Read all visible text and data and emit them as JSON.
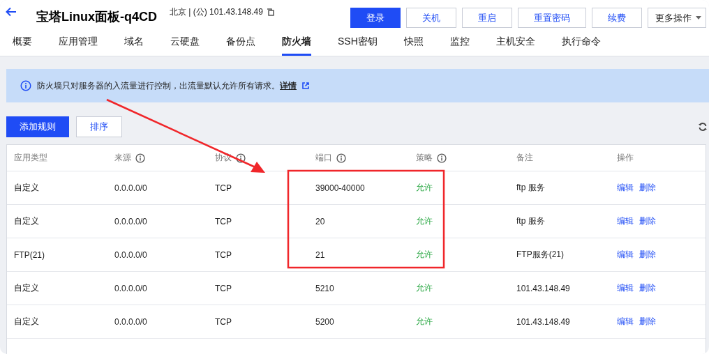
{
  "header": {
    "title": "宝塔Linux面板-q4CD",
    "location": "北京 | (公) 101.43.148.49",
    "buttons": [
      {
        "label": "登录",
        "primary": true
      },
      {
        "label": "关机",
        "primary": false
      },
      {
        "label": "重启",
        "primary": false
      },
      {
        "label": "重置密码",
        "primary": false
      },
      {
        "label": "续费",
        "primary": false
      }
    ],
    "more": "更多操作"
  },
  "tabs": [
    {
      "label": "概要",
      "selected": false
    },
    {
      "label": "应用管理",
      "selected": false
    },
    {
      "label": "域名",
      "selected": false
    },
    {
      "label": "云硬盘",
      "selected": false
    },
    {
      "label": "备份点",
      "selected": false
    },
    {
      "label": "防火墙",
      "selected": true
    },
    {
      "label": "SSH密钥",
      "selected": false
    },
    {
      "label": "快照",
      "selected": false
    },
    {
      "label": "监控",
      "selected": false
    },
    {
      "label": "主机安全",
      "selected": false
    },
    {
      "label": "执行命令",
      "selected": false
    }
  ],
  "notice": {
    "text": "防火墙只对服务器的入流量进行控制，出流量默认允许所有请求。",
    "link": "详情"
  },
  "toolbar": {
    "add": "添加规则",
    "sort": "排序"
  },
  "table": {
    "columns": [
      {
        "label": "应用类型",
        "info": false
      },
      {
        "label": "来源",
        "info": true
      },
      {
        "label": "协议",
        "info": true
      },
      {
        "label": "端口",
        "info": true
      },
      {
        "label": "策略",
        "info": true
      },
      {
        "label": "备注",
        "info": false
      },
      {
        "label": "操作",
        "info": false
      }
    ],
    "rows": [
      {
        "type": "自定义",
        "source": "0.0.0.0/0",
        "protocol": "TCP",
        "port": "39000-40000",
        "policy": "允许",
        "note": "ftp 服务",
        "actions": [
          "编辑",
          "删除"
        ]
      },
      {
        "type": "自定义",
        "source": "0.0.0.0/0",
        "protocol": "TCP",
        "port": "20",
        "policy": "允许",
        "note": "ftp 服务",
        "actions": [
          "编辑",
          "删除"
        ]
      },
      {
        "type": "FTP(21)",
        "source": "0.0.0.0/0",
        "protocol": "TCP",
        "port": "21",
        "policy": "允许",
        "note": "FTP服务(21)",
        "actions": [
          "编辑",
          "删除"
        ]
      },
      {
        "type": "自定义",
        "source": "0.0.0.0/0",
        "protocol": "TCP",
        "port": "5210",
        "policy": "允许",
        "note": "101.43.148.49",
        "actions": [
          "编辑",
          "删除"
        ]
      },
      {
        "type": "自定义",
        "source": "0.0.0.0/0",
        "protocol": "TCP",
        "port": "5200",
        "policy": "允许",
        "note": "101.43.148.49",
        "actions": [
          "编辑",
          "删除"
        ]
      }
    ]
  }
}
